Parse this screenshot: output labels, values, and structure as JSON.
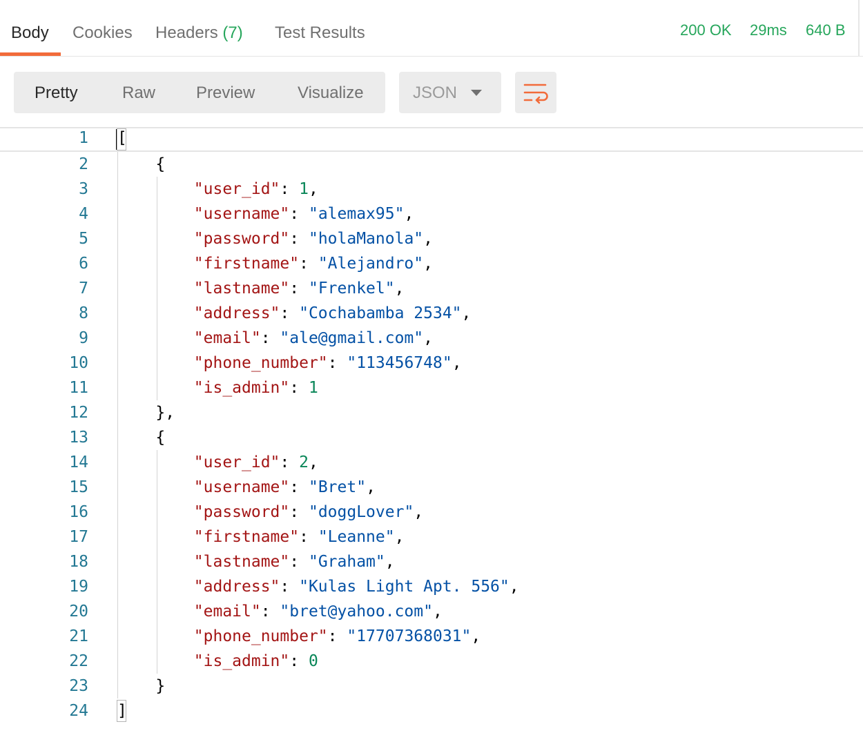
{
  "tabs": [
    {
      "label": "Body",
      "active": true
    },
    {
      "label": "Cookies"
    },
    {
      "label": "Headers",
      "count": "(7)"
    },
    {
      "label": "Test Results"
    }
  ],
  "status": {
    "code": "200 OK",
    "time": "29ms",
    "size": "640 B"
  },
  "view_modes": [
    "Pretty",
    "Raw",
    "Preview",
    "Visualize"
  ],
  "active_view_mode": "Pretty",
  "format": {
    "selected": "JSON",
    "icon": "chevron-down-icon"
  },
  "wrap_button": {
    "icon": "wrap-lines-icon",
    "color": "#f26b3a"
  },
  "colors": {
    "accent": "#f26b3a",
    "status": "#26a65b",
    "key": "#a31515",
    "string": "#0451a5",
    "number": "#098658",
    "gutter": "#237893"
  },
  "response": [
    {
      "user_id": 1,
      "username": "alemax95",
      "password": "holaManola",
      "firstname": "Alejandro",
      "lastname": "Frenkel",
      "address": "Cochabamba 2534",
      "email": "ale@gmail.com",
      "phone_number": "113456748",
      "is_admin": 1
    },
    {
      "user_id": 2,
      "username": "Bret",
      "password": "doggLover",
      "firstname": "Leanne",
      "lastname": "Graham",
      "address": "Kulas Light Apt. 556",
      "email": "bret@yahoo.com",
      "phone_number": "17707368031",
      "is_admin": 0
    }
  ]
}
